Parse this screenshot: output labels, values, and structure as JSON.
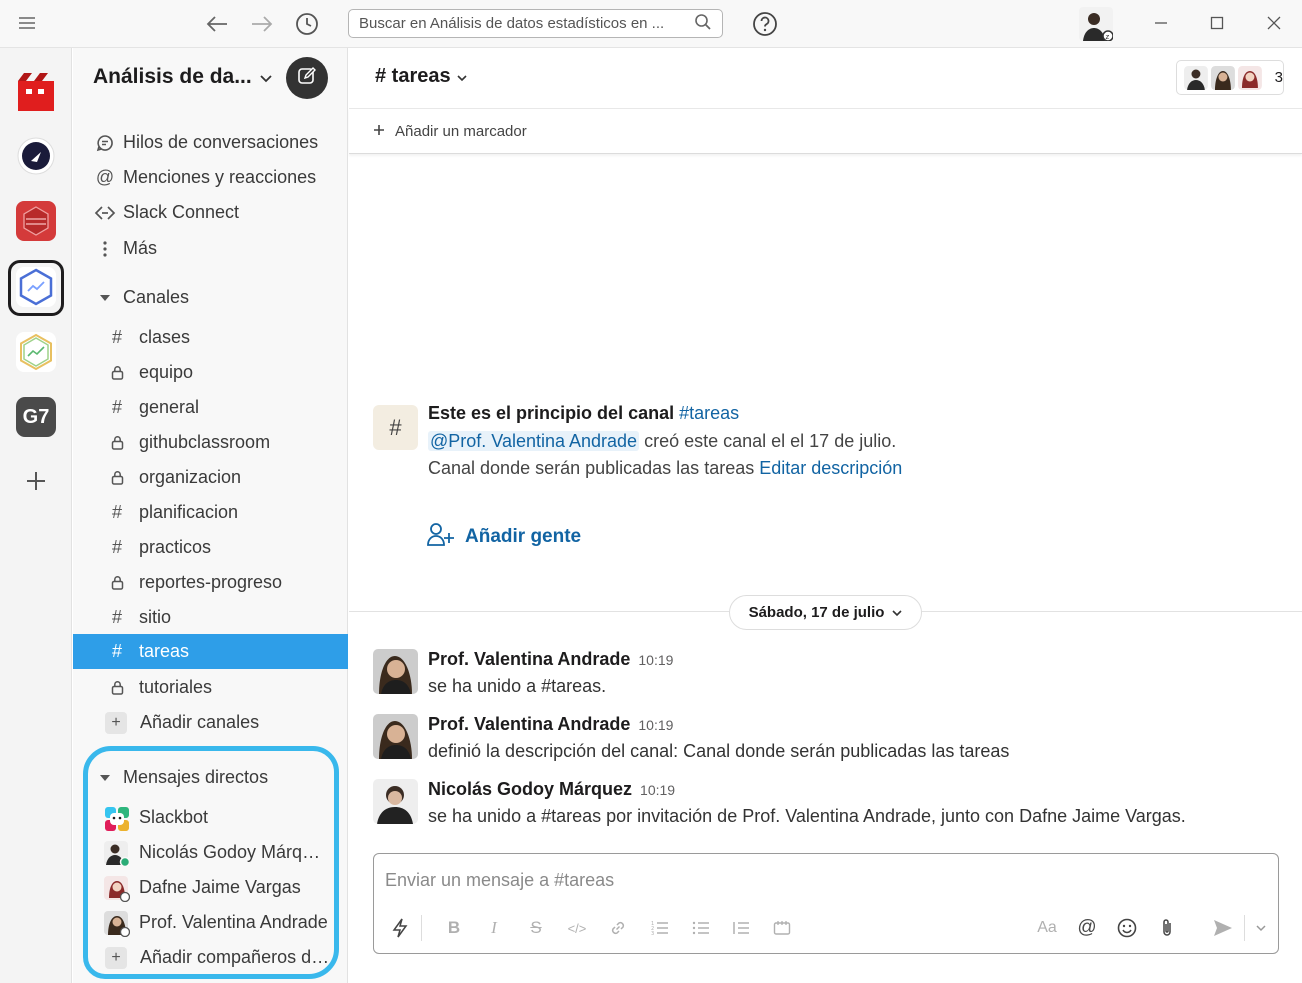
{
  "search": {
    "placeholder": "Buscar en Análisis de datos estadísticos en ..."
  },
  "workspaces": [
    {
      "name": "workspace-1",
      "color": "#e01e1e"
    },
    {
      "name": "workspace-2",
      "color": "#1a1b3a"
    },
    {
      "name": "workspace-3",
      "color": "#d43a3a"
    },
    {
      "name": "workspace-4",
      "color": "#4a6fd6"
    },
    {
      "name": "workspace-5",
      "color": "#8fc060"
    },
    {
      "name": "workspace-6",
      "label": "G7",
      "color": "#4a4a4a"
    }
  ],
  "sidebar": {
    "workspace_name": "Análisis de da...",
    "nav": [
      {
        "icon": "threads-icon",
        "label": "Hilos de conversaciones"
      },
      {
        "icon": "at-icon",
        "label": "Menciones y reacciones"
      },
      {
        "icon": "slack-connect-icon",
        "label": "Slack Connect"
      },
      {
        "icon": "more-icon",
        "label": "Más"
      }
    ],
    "channels_header": "Canales",
    "channels": [
      {
        "name": "clases",
        "private": false
      },
      {
        "name": "equipo",
        "private": true
      },
      {
        "name": "general",
        "private": false
      },
      {
        "name": "githubclassroom",
        "private": true
      },
      {
        "name": "organizacion",
        "private": true
      },
      {
        "name": "planificacion",
        "private": false
      },
      {
        "name": "practicos",
        "private": false
      },
      {
        "name": "reportes-progreso",
        "private": true
      },
      {
        "name": "sitio",
        "private": false
      },
      {
        "name": "tareas",
        "private": false,
        "active": true
      },
      {
        "name": "tutoriales",
        "private": true
      }
    ],
    "add_channels": "Añadir canales",
    "dm_header": "Mensajes directos",
    "dms": [
      {
        "name": "Slackbot"
      },
      {
        "name": "Nicolás Godoy Márquez"
      },
      {
        "name": "Dafne Jaime Vargas"
      },
      {
        "name": "Prof. Valentina Andrade"
      }
    ],
    "add_teammates": "Añadir compañeros de trabajo"
  },
  "channel": {
    "title": "# tareas",
    "member_count": "3",
    "add_bookmark": "Añadir un marcador",
    "intro": {
      "title_prefix": "Este es el principio del canal ",
      "title_channel": "#tareas",
      "creator": "@Prof. Valentina Andrade",
      "created_text": " creó este canal el el 17 de julio.",
      "description_prefix": "Canal donde serán publicadas las tareas ",
      "edit_description": "Editar descripción",
      "add_people": "Añadir gente"
    },
    "date_divider": "Sábado, 17 de julio",
    "messages": [
      {
        "author": "Prof. Valentina Andrade",
        "time": "10:19",
        "text": "se ha unido a #tareas."
      },
      {
        "author": "Prof. Valentina Andrade",
        "time": "10:19",
        "text": "definió la descripción del canal: Canal donde serán publicadas las tareas"
      },
      {
        "author": "Nicolás Godoy Márquez",
        "time": "10:19",
        "text": "se ha unido a #tareas por invitación de Prof. Valentina Andrade, junto con Dafne Jaime Vargas."
      }
    ],
    "composer": {
      "placeholder": "Enviar un mensaje a #tareas",
      "font_button": "Aa"
    }
  },
  "colors": {
    "active_channel": "#2e9ee8",
    "link": "#1264a3",
    "highlight": "#39b8ec"
  }
}
